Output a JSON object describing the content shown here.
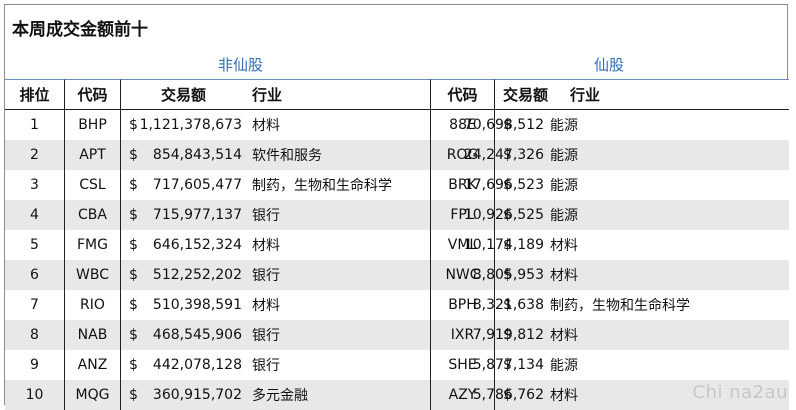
{
  "title": "本周成交金额前十",
  "groups": {
    "left": "非仙股",
    "right": "仙股"
  },
  "headers": {
    "rank": "排位",
    "code": "代码",
    "volume": "交易额",
    "industry": "行业",
    "code2": "代码",
    "volume2": "交易额",
    "industry2": "行业"
  },
  "currency": "$",
  "rows": [
    {
      "rank": "1",
      "code": "BHP",
      "amount": "1,121,378,673",
      "industry": "材料",
      "code2": "88E",
      "amount2": "70,698,512",
      "industry2": "能源"
    },
    {
      "rank": "2",
      "code": "APT",
      "amount": "854,843,514",
      "industry": "软件和服务",
      "code2": "ROG",
      "amount2": "24,247,326",
      "industry2": "能源"
    },
    {
      "rank": "3",
      "code": "CSL",
      "amount": "717,605,477",
      "industry": "制药，生物和生命科学",
      "code2": "BRK",
      "amount2": "17,696,523",
      "industry2": "能源"
    },
    {
      "rank": "4",
      "code": "CBA",
      "amount": "715,977,137",
      "industry": "银行",
      "code2": "FPL",
      "amount2": "10,926,525",
      "industry2": "能源"
    },
    {
      "rank": "5",
      "code": "FMG",
      "amount": "646,152,324",
      "industry": "材料",
      "code2": "VML",
      "amount2": "10,174,189",
      "industry2": "材料"
    },
    {
      "rank": "6",
      "code": "WBC",
      "amount": "512,252,202",
      "industry": "银行",
      "code2": "NWC",
      "amount2": "8,805,953",
      "industry2": "材料"
    },
    {
      "rank": "7",
      "code": "RIO",
      "amount": "510,398,591",
      "industry": "材料",
      "code2": "BPH",
      "amount2": "8,321,638",
      "industry2": "制药，生物和生命科学"
    },
    {
      "rank": "8",
      "code": "NAB",
      "amount": "468,545,906",
      "industry": "银行",
      "code2": "IXR",
      "amount2": "7,919,812",
      "industry2": "材料"
    },
    {
      "rank": "9",
      "code": "ANZ",
      "amount": "442,078,128",
      "industry": "银行",
      "code2": "SHE",
      "amount2": "5,877,134",
      "industry2": "能源"
    },
    {
      "rank": "10",
      "code": "MQG",
      "amount": "360,915,702",
      "industry": "多元金融",
      "code2": "AZY",
      "amount2": "5,786,762",
      "industry2": "材料"
    }
  ],
  "watermark": "Chi na2au"
}
